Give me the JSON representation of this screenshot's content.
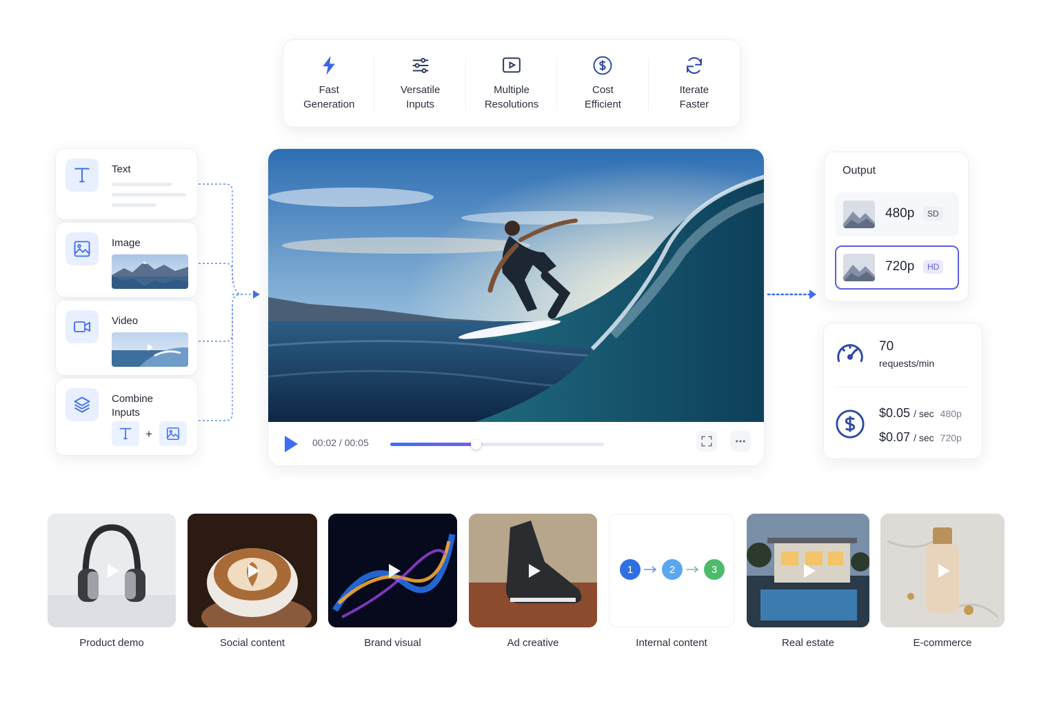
{
  "features": [
    {
      "icon": "lightning-icon",
      "label": "Fast\nGeneration"
    },
    {
      "icon": "sliders-icon",
      "label": "Versatile\nInputs"
    },
    {
      "icon": "video-resolution-icon",
      "label": "Multiple\nResolutions"
    },
    {
      "icon": "dollar-coin-icon",
      "label": "Cost\nEfficient"
    },
    {
      "icon": "refresh-icon",
      "label": "Iterate\nFaster"
    }
  ],
  "inputs": {
    "text": {
      "icon": "text-icon",
      "label": "Text"
    },
    "image": {
      "icon": "image-icon",
      "label": "Image"
    },
    "video": {
      "icon": "video-camera-icon",
      "label": "Video"
    },
    "combine": {
      "icon": "layers-icon",
      "label": "Combine\nInputs",
      "plus": "+"
    }
  },
  "player": {
    "time": "00:02 / 00:05",
    "progress": 0.4,
    "play_icon": "play-icon",
    "fullscreen_icon": "fullscreen-icon",
    "more_icon": "more-icon"
  },
  "output": {
    "title": "Output",
    "resolutions": [
      {
        "label": "480p",
        "badge": "SD",
        "selected": false
      },
      {
        "label": "720p",
        "badge": "HD",
        "selected": true
      }
    ]
  },
  "stats": {
    "rpm_value": "70",
    "rpm_label": "requests/min",
    "price_480": {
      "amount": "$0.05",
      "unit": "/ sec",
      "res": "480p"
    },
    "price_720": {
      "amount": "$0.07",
      "unit": "/ sec",
      "res": "720p"
    }
  },
  "use_cases": [
    {
      "label": "Product demo"
    },
    {
      "label": "Social content"
    },
    {
      "label": "Brand visual"
    },
    {
      "label": "Ad creative"
    },
    {
      "label": "Internal content",
      "steps": [
        "1",
        "2",
        "3"
      ]
    },
    {
      "label": "Real estate"
    },
    {
      "label": "E-commerce"
    }
  ],
  "colors": {
    "accent": "#3e6ff0",
    "selected_border": "#5a5ee0",
    "step_1": "#2f6fe4",
    "step_2": "#5aa7f0",
    "step_3": "#4cbb6c"
  }
}
